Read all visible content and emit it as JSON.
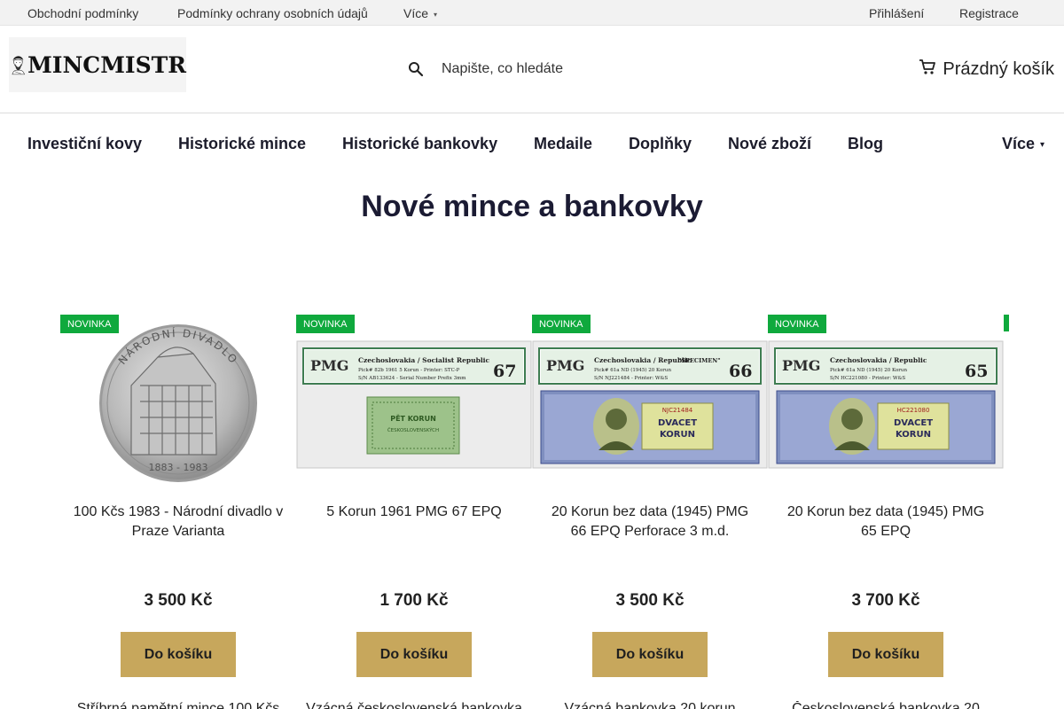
{
  "topbar": {
    "links": [
      "Obchodní podmínky",
      "Podmínky ochrany osobních údajů",
      "Více"
    ],
    "login": "Přihlášení",
    "register": "Registrace"
  },
  "header": {
    "logo_text": "MINCMISTR",
    "search_placeholder": "Napište, co hledáte",
    "cart_label": "Prázdný košík"
  },
  "nav": {
    "items": [
      "Investiční kovy",
      "Historické mince",
      "Historické bankovky",
      "Medaile",
      "Doplňky",
      "Nové zboží",
      "Blog"
    ],
    "more": "Více"
  },
  "section_title": "Nové mince a bankovky",
  "products": [
    {
      "badge": "NOVINKA",
      "name": "100 Kčs 1983 - Národní divadlo v Praze Varianta",
      "price": "3 500 Kč",
      "button": "Do košíku",
      "next_name": "Stříbrná pamětní mince 100 Kčs"
    },
    {
      "badge": "NOVINKA",
      "name": "5 Korun 1961 PMG 67 EPQ",
      "price": "1 700 Kč",
      "button": "Do košíku",
      "next_name": "Vzácná československá bankovka"
    },
    {
      "badge": "NOVINKA",
      "name": "20 Korun bez data (1945) PMG 66 EPQ Perforace 3 m.d.",
      "price": "3 500 Kč",
      "button": "Do košíku",
      "next_name": "Vzácná bankovka 20 korun"
    },
    {
      "badge": "NOVINKA",
      "name": "20 Korun bez data (1945) PMG 65 EPQ",
      "price": "3 700 Kč",
      "button": "Do košíku",
      "next_name": "Československá bankovka 20"
    }
  ],
  "slabs": [
    {
      "grade": "67",
      "title": "Czechoslovakia / Socialist Republic",
      "line2": "Pick# 82b  1961  5 Korun - Printer: STC-P",
      "line3": "S/N AB133624 - Serial Number Prefix 3mm",
      "note_text1": "PĚT KORUN",
      "note_text2": "ČESKOSLOVENSKÝCH"
    },
    {
      "grade": "66",
      "title": "Czechoslovakia / Republic",
      "line2": "Pick# 61a  ND (1945)  20 Korun",
      "line3": "S/N NJ221484 - Printer: W&S",
      "note_text1": "DVACET",
      "note_text2": "KORUN",
      "serial": "NJC21484",
      "stamp": "\"SPECIMEN\""
    },
    {
      "grade": "65",
      "title": "Czechoslovakia / Republic",
      "line2": "Pick# 61a  ND (1945)  20 Korun",
      "line3": "S/N HC221080 - Printer: W&S",
      "note_text1": "DVACET",
      "note_text2": "KORUN",
      "serial": "HC221080"
    }
  ],
  "coin": {
    "legend_top": "NÁRODNÍ DIVADLO",
    "years": "1883 - 1983"
  },
  "pmg_label": "PMG",
  "colors": {
    "badge": "#0fa93d",
    "button": "#c7a75c",
    "heading": "#1b1b33"
  }
}
